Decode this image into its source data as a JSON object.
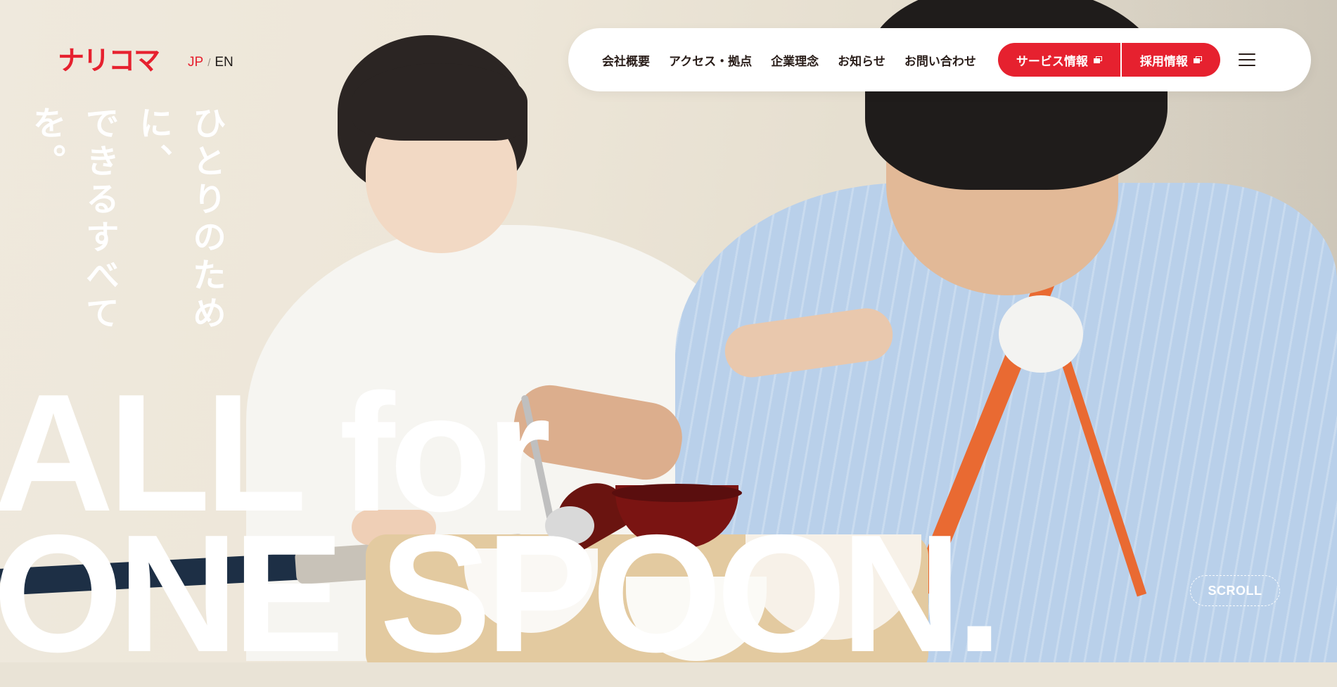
{
  "logo": {
    "text": "ナリコマ",
    "color": "#e6212f"
  },
  "language": {
    "jp": "JP",
    "separator": "/",
    "en": "EN",
    "active": "JP"
  },
  "catch_copy": {
    "line1": "ひとりのために、",
    "line2": "できるすべてを。"
  },
  "headline": {
    "line1": "ALL for",
    "line2": "ONE SPOON."
  },
  "nav": {
    "links": [
      "会社概要",
      "アクセス・拠点",
      "企業理念",
      "お知らせ",
      "お問い合わせ"
    ],
    "service_button": "サービス情報",
    "recruit_button": "採用情報",
    "menu_icon": "hamburger-icon",
    "external_icon": "external-window-icon"
  },
  "scroll": {
    "label": "SCROLL"
  },
  "colors": {
    "accent": "#e6212f",
    "text_dark": "#2a1e1a",
    "white": "#ffffff"
  },
  "hero_image": {
    "icon": "hero-photo"
  }
}
